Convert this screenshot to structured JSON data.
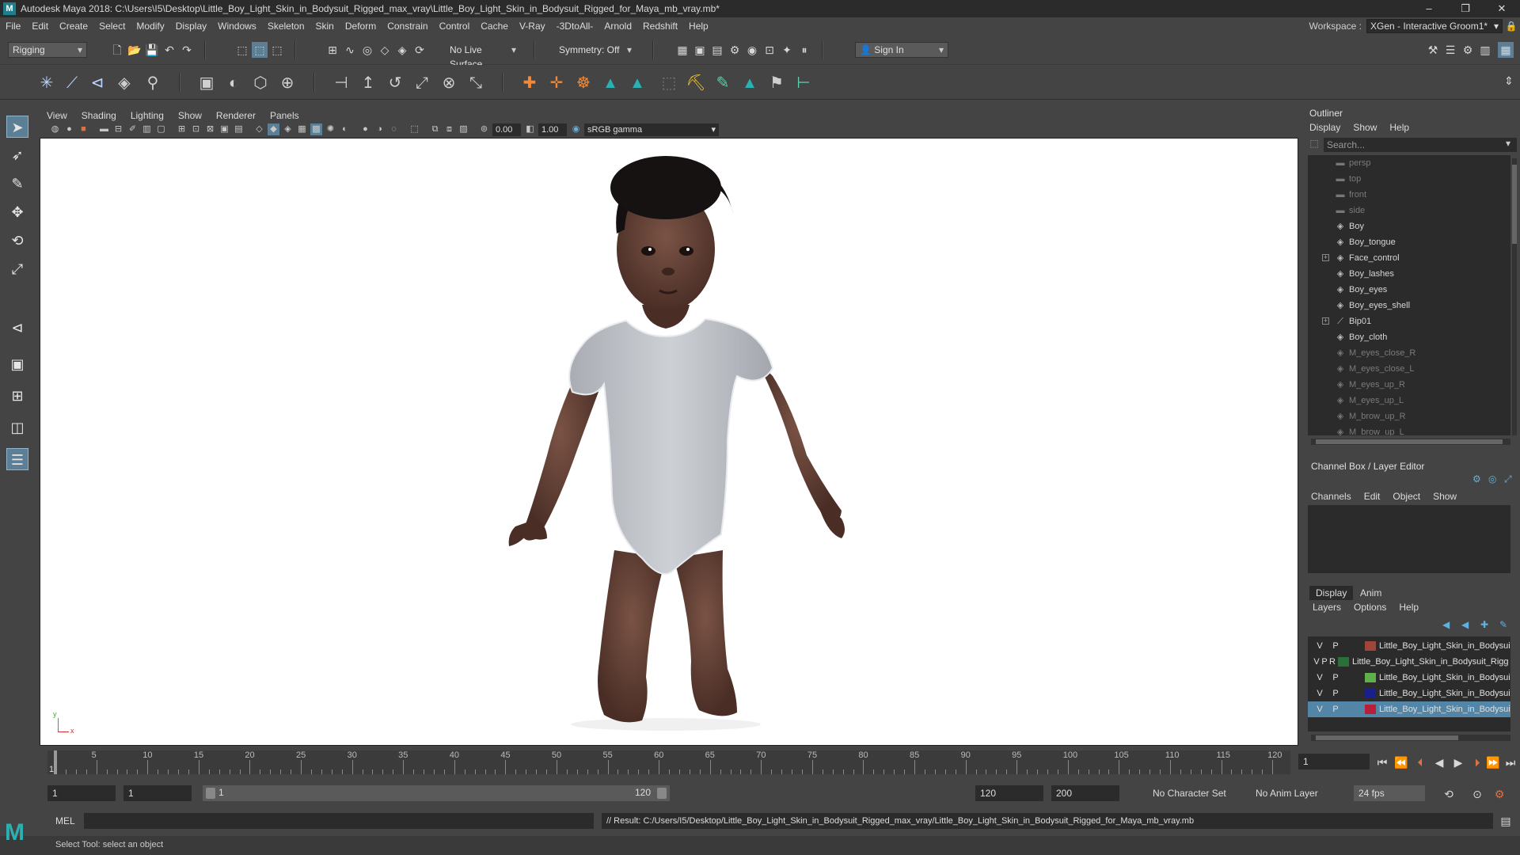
{
  "app": {
    "title": "Autodesk Maya 2018: C:\\Users\\I5\\Desktop\\Little_Boy_Light_Skin_in_Bodysuit_Rigged_max_vray\\Little_Boy_Light_Skin_in_Bodysuit_Rigged_for_Maya_mb_vray.mb*",
    "minimize": "–",
    "restore": "❐",
    "close": "✕"
  },
  "menubar": {
    "items": [
      "File",
      "Edit",
      "Create",
      "Select",
      "Modify",
      "Display",
      "Windows",
      "Skeleton",
      "Skin",
      "Deform",
      "Constrain",
      "Control",
      "Cache",
      "V-Ray",
      "-3DtoAll-",
      "Arnold",
      "Redshift",
      "Help"
    ],
    "workspace_label": "Workspace :",
    "workspace_value": "XGen - Interactive Groom1*"
  },
  "statusline": {
    "menu_set": "Rigging",
    "live_surface": "No Live Surface",
    "symmetry": "Symmetry: Off",
    "sign_in": "Sign In"
  },
  "viewport": {
    "menus": [
      "View",
      "Shading",
      "Lighting",
      "Show",
      "Renderer",
      "Panels"
    ],
    "exposure": "0.00",
    "gamma": "1.00",
    "color_space": "sRGB gamma",
    "axis_x": "x",
    "axis_y": "y"
  },
  "outliner": {
    "title": "Outliner",
    "menus": [
      "Display",
      "Show",
      "Help"
    ],
    "search_placeholder": "Search...",
    "items": [
      {
        "label": "persp",
        "icon": "camera-icon",
        "dim": true,
        "expandable": false
      },
      {
        "label": "top",
        "icon": "camera-icon",
        "dim": true,
        "expandable": false
      },
      {
        "label": "front",
        "icon": "camera-icon",
        "dim": true,
        "expandable": false
      },
      {
        "label": "side",
        "icon": "camera-icon",
        "dim": true,
        "expandable": false
      },
      {
        "label": "Boy",
        "icon": "mesh-icon",
        "dim": false,
        "expandable": false
      },
      {
        "label": "Boy_tongue",
        "icon": "mesh-icon",
        "dim": false,
        "expandable": false
      },
      {
        "label": "Face_control",
        "icon": "mesh-icon",
        "dim": false,
        "expandable": true
      },
      {
        "label": "Boy_lashes",
        "icon": "mesh-icon",
        "dim": false,
        "expandable": false
      },
      {
        "label": "Boy_eyes",
        "icon": "mesh-icon",
        "dim": false,
        "expandable": false
      },
      {
        "label": "Boy_eyes_shell",
        "icon": "mesh-icon",
        "dim": false,
        "expandable": false
      },
      {
        "label": "Bip01",
        "icon": "joint-icon",
        "dim": false,
        "expandable": true
      },
      {
        "label": "Boy_cloth",
        "icon": "mesh-icon",
        "dim": false,
        "expandable": false
      },
      {
        "label": "M_eyes_close_R",
        "icon": "mesh-icon",
        "dim": true,
        "expandable": false
      },
      {
        "label": "M_eyes_close_L",
        "icon": "mesh-icon",
        "dim": true,
        "expandable": false
      },
      {
        "label": "M_eyes_up_R",
        "icon": "mesh-icon",
        "dim": true,
        "expandable": false
      },
      {
        "label": "M_eyes_up_L",
        "icon": "mesh-icon",
        "dim": true,
        "expandable": false
      },
      {
        "label": "M_brow_up_R",
        "icon": "mesh-icon",
        "dim": true,
        "expandable": false
      },
      {
        "label": "M_brow_up_L",
        "icon": "mesh-icon",
        "dim": true,
        "expandable": false
      }
    ]
  },
  "channelbox": {
    "title": "Channel Box / Layer Editor",
    "menus": [
      "Channels",
      "Edit",
      "Object",
      "Show"
    ]
  },
  "layereditor": {
    "tabs": [
      "Display",
      "Anim"
    ],
    "menus": [
      "Layers",
      "Options",
      "Help"
    ],
    "layers": [
      {
        "flags": [
          "V",
          "P",
          ""
        ],
        "color": "#a0453a",
        "name": "Little_Boy_Light_Skin_in_Bodysuit",
        "selected": false
      },
      {
        "flags": [
          "V",
          "P",
          "R"
        ],
        "color": "#2b6f3a",
        "name": "Little_Boy_Light_Skin_in_Bodysuit_Rigg",
        "selected": false
      },
      {
        "flags": [
          "V",
          "P",
          ""
        ],
        "color": "#5fb04a",
        "name": "Little_Boy_Light_Skin_in_Bodysuit_Ri",
        "selected": false
      },
      {
        "flags": [
          "V",
          "P",
          ""
        ],
        "color": "#1b1f8a",
        "name": "Little_Boy_Light_Skin_in_Bodysuit",
        "selected": false
      },
      {
        "flags": [
          "V",
          "P",
          ""
        ],
        "color": "#b8203a",
        "name": "Little_Boy_Light_Skin_in_Bodysuit",
        "selected": true
      }
    ]
  },
  "timeslider": {
    "ticks": [
      "5",
      "10",
      "15",
      "20",
      "25",
      "30",
      "35",
      "40",
      "45",
      "50",
      "55",
      "60",
      "65",
      "70",
      "75",
      "80",
      "85",
      "90",
      "95",
      "100",
      "105",
      "110",
      "115",
      "120"
    ],
    "start_label": "1",
    "current_frame": "1"
  },
  "rangeslider": {
    "start": "1",
    "anim_start": "1",
    "range_start": "1",
    "range_end": "120",
    "playback_end": "120",
    "anim_end": "200",
    "character_set": "No Character Set",
    "anim_layer": "No Anim Layer",
    "fps": "24 fps"
  },
  "cmdline": {
    "lang": "MEL",
    "result": "// Result: C:/Users/I5/Desktop/Little_Boy_Light_Skin_in_Bodysuit_Rigged_max_vray/Little_Boy_Light_Skin_in_Bodysuit_Rigged_for_Maya_mb_vray.mb"
  },
  "helpline": {
    "text": "Select Tool: select an object"
  },
  "logo": "M"
}
